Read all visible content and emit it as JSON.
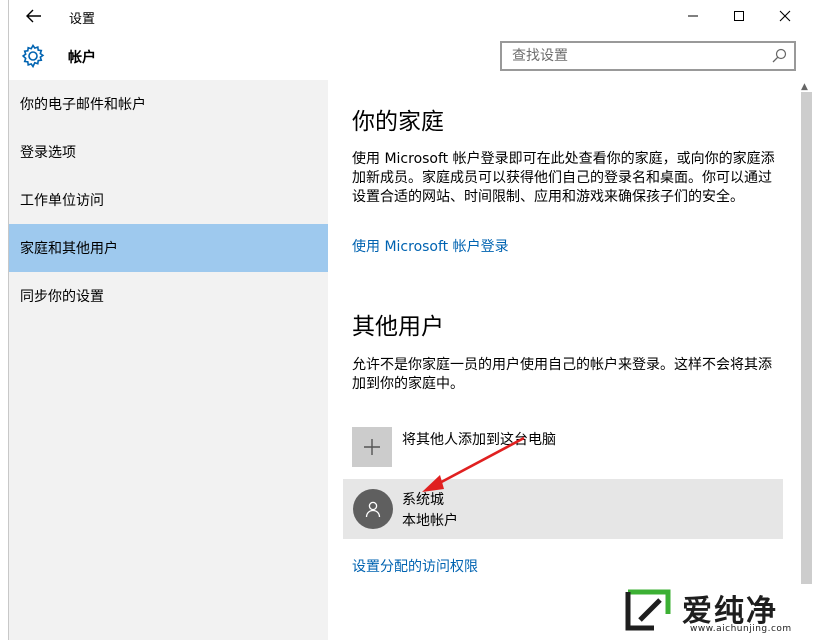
{
  "window": {
    "title": "设置",
    "controls": {
      "minimize": "—",
      "maximize": "☐",
      "close": "✕"
    }
  },
  "header": {
    "title": "帐户",
    "search_placeholder": "查找设置"
  },
  "sidebar": {
    "items": [
      {
        "label": "你的电子邮件和帐户",
        "active": false
      },
      {
        "label": "登录选项",
        "active": false
      },
      {
        "label": "工作单位访问",
        "active": false
      },
      {
        "label": "家庭和其他用户",
        "active": true
      },
      {
        "label": "同步你的设置",
        "active": false
      }
    ]
  },
  "family": {
    "heading": "你的家庭",
    "description": "使用 Microsoft 帐户登录即可在此处查看你的家庭，或向你的家庭添加新成员。家庭成员可以获得他们自己的登录名和桌面。你可以通过设置合适的网站、时间限制、应用和游戏来确保孩子们的安全。",
    "signin_link": "使用 Microsoft 帐户登录"
  },
  "other_users": {
    "heading": "其他用户",
    "description": "允许不是你家庭一员的用户使用自己的帐户来登录。这样不会将其添加到你的家庭中。",
    "add_label": "将其他人添加到这台电脑",
    "user": {
      "name": "系统城",
      "type": "本地帐户"
    },
    "access_link": "设置分配的访问权限"
  },
  "watermark": {
    "text": "爱纯净",
    "url": "www.aichunjing.com"
  },
  "colors": {
    "accent": "#0063b1",
    "active_nav": "#9ec9ee",
    "sidebar_bg": "#f2f2f2",
    "annotation_arrow": "#e02020"
  }
}
